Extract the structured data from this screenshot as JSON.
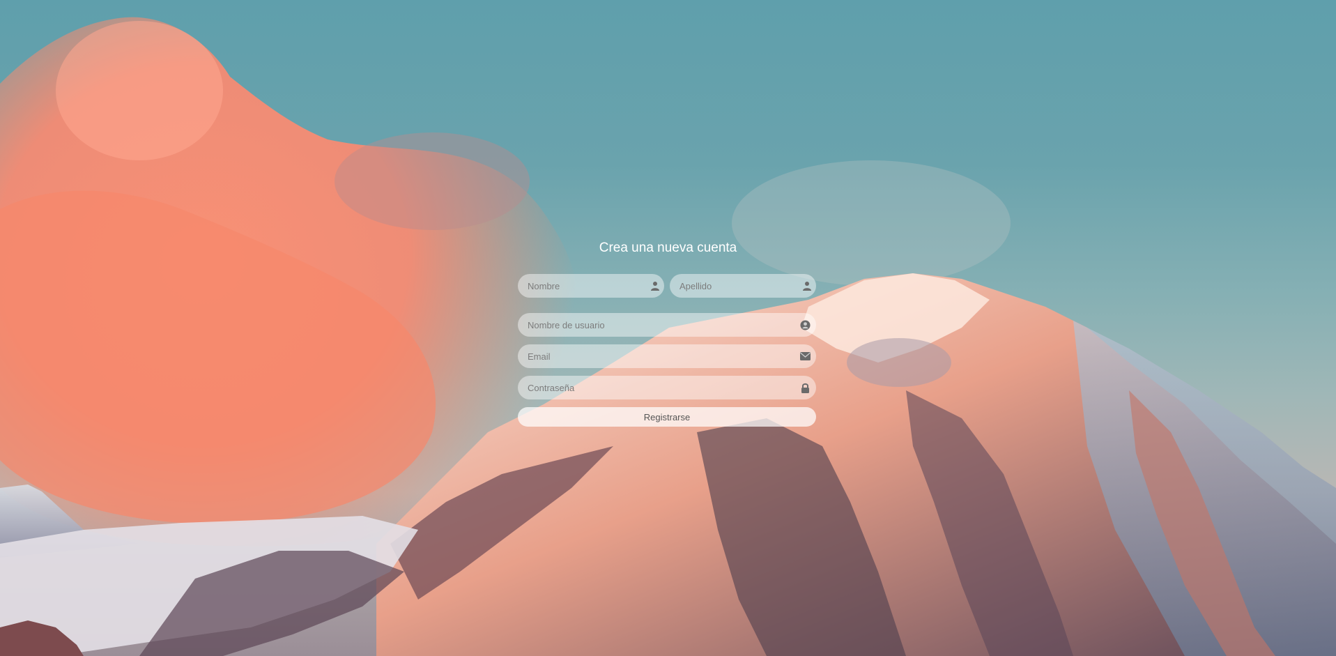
{
  "form": {
    "title": "Crea una nueva cuenta",
    "fields": {
      "first_name": {
        "placeholder": "Nombre",
        "icon": "user-icon"
      },
      "last_name": {
        "placeholder": "Apellido",
        "icon": "user-icon"
      },
      "username": {
        "placeholder": "Nombre de usuario",
        "icon": "user-circle-icon"
      },
      "email": {
        "placeholder": "Email",
        "icon": "envelope-icon"
      },
      "password": {
        "placeholder": "Contraseña",
        "icon": "lock-icon"
      }
    },
    "submit_label": "Registrarse"
  },
  "colors": {
    "sky": "#5f9fac",
    "cloud": "#f28c6e",
    "mountain_light": "#f4b9a0",
    "mountain_dark": "#4a3848",
    "field_bg": "rgba(255,255,255,0.45)",
    "icon": "#6a6a6a"
  }
}
